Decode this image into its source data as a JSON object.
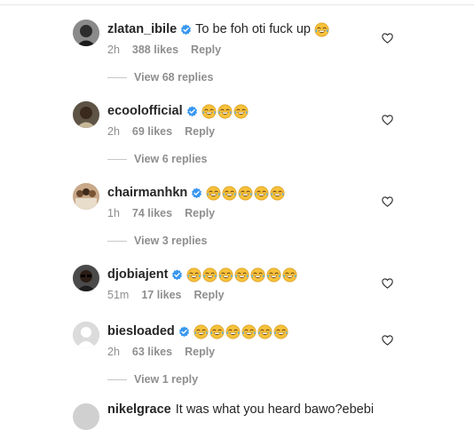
{
  "comments": [
    {
      "username": "zlatan_ibile",
      "verified": true,
      "text": "To be foh oti fuck up",
      "emoji_count": 1,
      "emoji": "face-with-tears-of-joy",
      "time": "2h",
      "likes": "388 likes",
      "reply_label": "Reply",
      "avatar": "dark-portrait",
      "view_replies": "View 68 replies"
    },
    {
      "username": "ecoolofficial",
      "verified": true,
      "text": "",
      "emoji_count": 3,
      "emoji": "face-with-tears-of-joy",
      "time": "2h",
      "likes": "69 likes",
      "reply_label": "Reply",
      "avatar": "portrait",
      "view_replies": "View 6 replies"
    },
    {
      "username": "chairmanhkn",
      "verified": true,
      "text": "",
      "emoji_count": 5,
      "emoji": "face-with-tears-of-joy",
      "time": "1h",
      "likes": "74 likes",
      "reply_label": "Reply",
      "avatar": "group-photo",
      "view_replies": "View 3 replies"
    },
    {
      "username": "djobiajent",
      "verified": true,
      "text": "",
      "emoji_count": 7,
      "emoji": "face-with-tears-of-joy",
      "time": "51m",
      "likes": "17 likes",
      "reply_label": "Reply",
      "avatar": "portrait-glasses",
      "view_replies": ""
    },
    {
      "username": "biesloaded",
      "verified": true,
      "text": "",
      "emoji_count": 6,
      "emoji": "face-with-tears-of-joy",
      "time": "2h",
      "likes": "63 likes",
      "reply_label": "Reply",
      "avatar": "default-avatar",
      "view_replies": "View 1 reply"
    }
  ],
  "partial_comment": {
    "username": "nikelgrace",
    "text": "It was what you heard bawo?ebebi"
  },
  "colors": {
    "text": "#262626",
    "meta": "#8e8e8e",
    "verified": "#3897f0",
    "emoji_face": "#f7c23a"
  },
  "icons": {
    "like": "heart-outline-icon",
    "verified": "verified-badge-icon"
  }
}
